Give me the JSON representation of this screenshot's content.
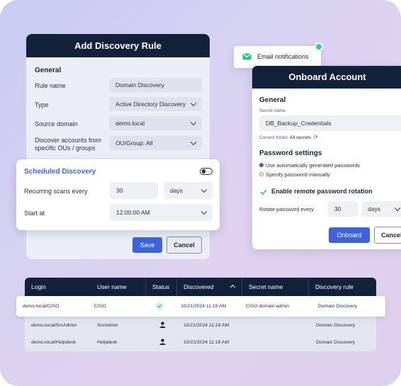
{
  "discovery_rule": {
    "title": "Add Discovery Rule",
    "section": "General",
    "fields": {
      "rule_name": {
        "label": "Rule name",
        "value": "Domain Discovery"
      },
      "type": {
        "label": "Type",
        "value": "Active Directory Discovery"
      },
      "source_domain": {
        "label": "Source domain",
        "value": "demo.local"
      },
      "ous": {
        "label_line1": "Discover accounts from",
        "label_line2": "specific OUs / groups",
        "value": "OU/Group: All"
      }
    },
    "save_label": "Save",
    "cancel_label": "Cancel"
  },
  "scheduled": {
    "title": "Scheduled Discovery",
    "recurring_label": "Recurring scans every",
    "recurring_value": "30",
    "recurring_unit": "days",
    "start_label": "Start at",
    "start_value": "12:00:00 AM"
  },
  "email_notifications": {
    "label": "Email notifications"
  },
  "onboard": {
    "title": "Onboard Account",
    "section": "General",
    "secret_name_label": "Secret name",
    "secret_name_value": "DB_Backup_Credentials",
    "current_folder_prefix": "Current folder:",
    "current_folder_value": "All secrets",
    "password_settings_title": "Password settings",
    "radio_auto": "Use automatically generated passwords",
    "radio_manual": "Specify password manually",
    "rotation_label": "Enable remote password rotation",
    "rotate_label": "Rotate password every",
    "rotate_value": "30",
    "rotate_unit": "days",
    "onboard_label": "Onboard",
    "cancel_label": "Cancel"
  },
  "table": {
    "columns": [
      "Login",
      "User name",
      "Status",
      "Discovered",
      "Secret name",
      "Discovery rule"
    ],
    "rows": [
      {
        "login": "demo.local/CISO",
        "user": "CISO",
        "status": "check",
        "discovered": "10/21/2024 11:19 AM",
        "secret": "CISO domain admin",
        "rule": "Domain Discovery"
      },
      {
        "login": "demo.local/SrvAdmin",
        "user": "SrvAdmin",
        "status": "user",
        "discovered": "10/21/2024 11:19 AM",
        "secret": "",
        "rule": "Domain Discovery"
      },
      {
        "login": "demo.local/Helpdesk",
        "user": "Helpdesk",
        "status": "user",
        "discovered": "10/21/2024 11:19 AM",
        "secret": "",
        "rule": "Domain Discovery"
      }
    ]
  },
  "colors": {
    "navy": "#14213a",
    "accent_blue": "#3d63dd",
    "green": "#2ec47a"
  },
  "icons": [
    "chevron-down-icon",
    "toggle-switch",
    "envelope-icon",
    "refresh-icon",
    "check-icon",
    "user-icon",
    "sort-up-icon"
  ]
}
